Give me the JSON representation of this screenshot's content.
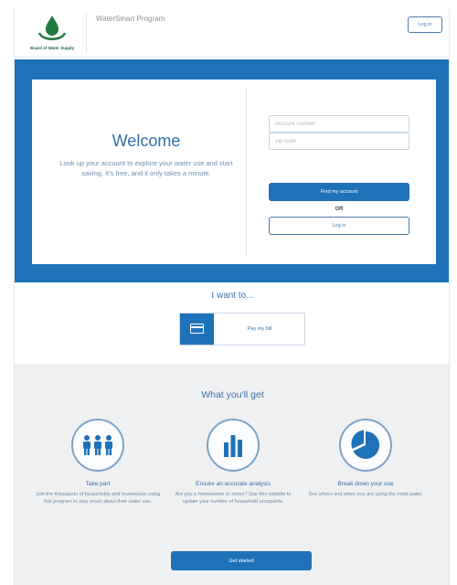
{
  "header": {
    "logo_caption": "Board of Water Supply",
    "program_name": "WaterSmart Program",
    "login_label": "Log in"
  },
  "hero": {
    "welcome_title": "Welcome",
    "welcome_text": "Look up your account to explore your water use and start saving. It's free, and it only takes a minute.",
    "account_placeholder": "Account number",
    "zip_placeholder": "Zip code",
    "find_button": "Find my account",
    "or_text": "OR",
    "login_button": "Log in"
  },
  "want": {
    "title": "I want to...",
    "pay_label": "Pay my bill",
    "pay_icon": "credit-card-icon"
  },
  "get": {
    "title": "What you'll get",
    "features": [
      {
        "icon": "people-icon",
        "title": "Take part",
        "text": "Join the thousands of households and businesses using this program to stay smart about their water use."
      },
      {
        "icon": "bar-chart-icon",
        "title": "Ensure an accurate analysis",
        "text": "Are you a homeowner or renter? Use this website to update your number of household occupants."
      },
      {
        "icon": "pie-chart-icon",
        "title": "Break down your use",
        "text": "See where and when you are using the most water."
      }
    ],
    "start_button": "Get started"
  },
  "colors": {
    "brand_blue": "#1f72b8",
    "logo_green": "#1f7a3f",
    "section_gray": "#eef0f2"
  }
}
